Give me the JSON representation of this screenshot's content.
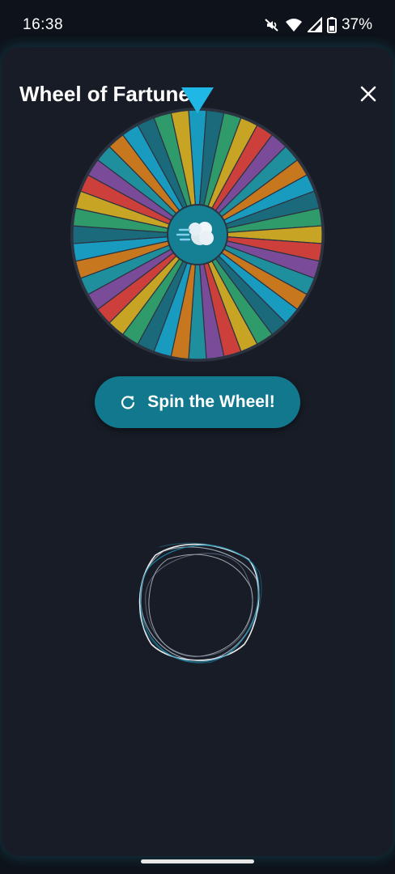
{
  "status_bar": {
    "time": "16:38",
    "battery": "37%",
    "icons": [
      "mute-icon",
      "wifi-icon",
      "signal-icon",
      "battery-icon"
    ]
  },
  "sheet": {
    "title": "Wheel of Fartune",
    "close_icon": "close-icon"
  },
  "wheel": {
    "segment_count": 44,
    "segment_colors": [
      "#189bbf",
      "#1b6a7c",
      "#2f9a6a",
      "#c8a425",
      "#cc3f3a",
      "#7a4b99",
      "#1f8e9d",
      "#c7781f"
    ],
    "center_icon": "wind-cloud-icon",
    "pointer_icon": "pointer-triangle-icon",
    "accent": "#1fb8e6"
  },
  "spin_button": {
    "label": "Spin the Wheel!",
    "icon": "refresh-icon",
    "color": "#12788d"
  },
  "loader": {
    "icon": "loading-scribble-icon"
  }
}
